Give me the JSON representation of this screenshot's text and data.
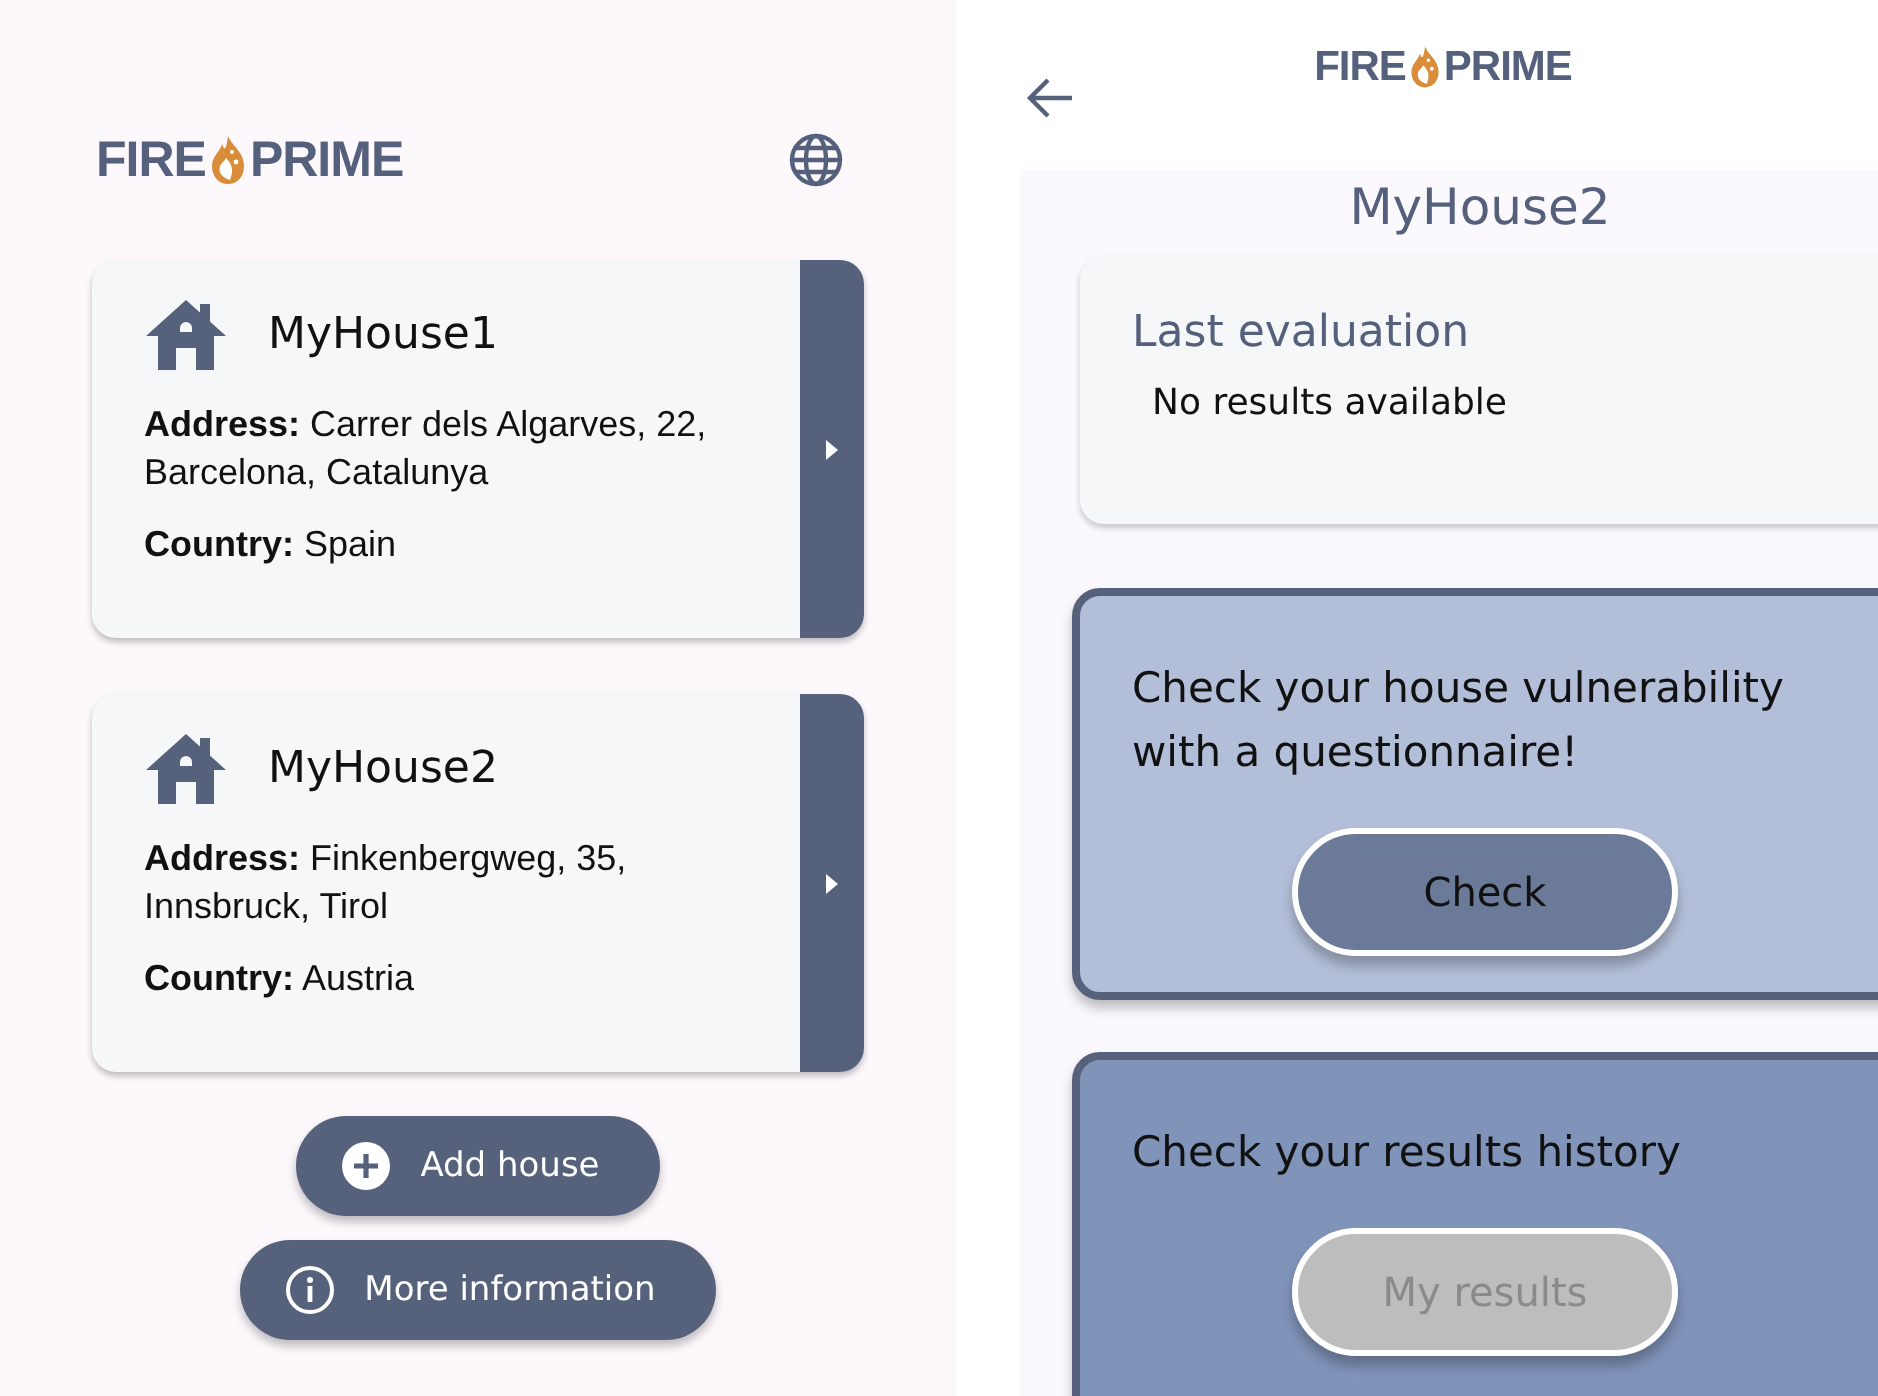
{
  "left_screen": {
    "logo": {
      "left": "FIRE",
      "right": "PRIME"
    },
    "houses": [
      {
        "name": "MyHouse1",
        "address": "**Address:** Carrer dels Algarves, 22, Barcelona, Catalunya",
        "country": "**Country:** Spain"
      },
      {
        "name": "MyHouse2",
        "address": "**Address:** Finkenbergweg, 35, Innsbruck, Tirol",
        "country": "**Country:** Austria"
      }
    ],
    "buttons": [
      {
        "kind": "add",
        "label": "Add house"
      },
      {
        "kind": "info",
        "label": "More information"
      }
    ]
  },
  "right_screen": {
    "logo": {
      "left": "FIRE",
      "right": "PRIME"
    },
    "title": "MyHouse2",
    "last_evaluation": {
      "title": "Last evaluation",
      "text": "No results available"
    },
    "cards": [
      {
        "kind": "light",
        "text": "Check your house vulnerability with a questionnaire!",
        "button": {
          "label": "Check",
          "disabled": false
        }
      },
      {
        "kind": "dark",
        "text": "Check your results history",
        "button": {
          "label": "My results",
          "disabled": true
        }
      }
    ]
  }
}
